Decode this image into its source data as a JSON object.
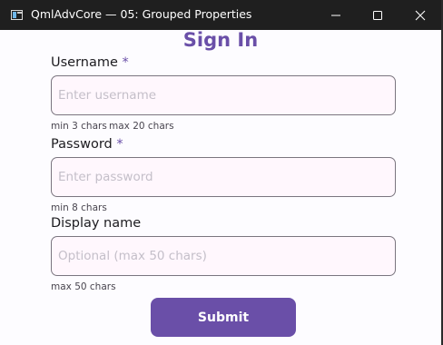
{
  "window": {
    "title": "QmlAdvCore — 05: Grouped Properties",
    "icon": "app-window-icon",
    "controls": [
      "minimize-icon",
      "maximize-icon",
      "close-icon"
    ]
  },
  "form": {
    "heading": "Sign In",
    "username": {
      "label": "Username",
      "required_mark": "*",
      "placeholder": "Enter username",
      "value": "",
      "hint_min": "min 3 chars",
      "hint_max": "max 20 chars"
    },
    "password": {
      "label": "Password",
      "required_mark": "*",
      "placeholder": "Enter password",
      "value": "",
      "hint_min": "min 8 chars"
    },
    "display_name": {
      "label": "Display name",
      "placeholder": "Optional (max 50 chars)",
      "value": "",
      "hint_max": "max 50 chars"
    },
    "submit_label": "Submit"
  },
  "colors": {
    "accent": "#6a4fa8",
    "titlebar": "#1f1f1f",
    "field_border": "#7a757f",
    "field_background": "#fff7fd"
  }
}
